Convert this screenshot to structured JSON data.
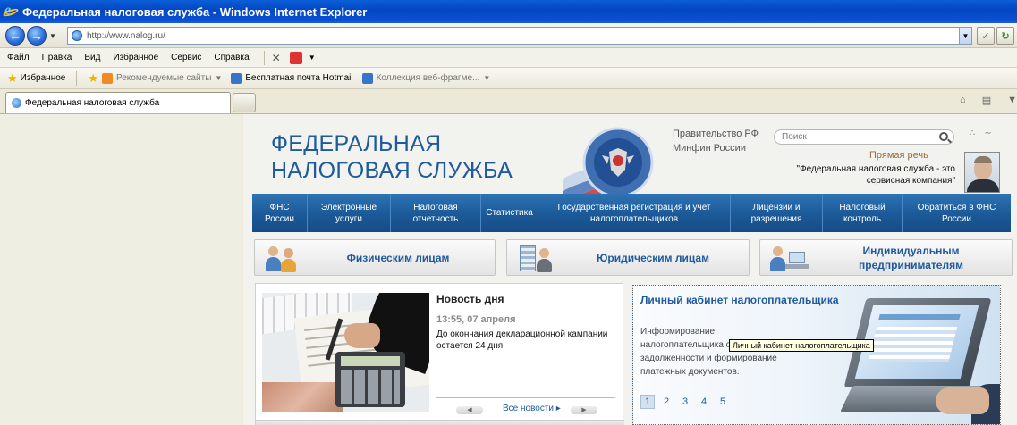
{
  "window": {
    "title": "Федеральная налоговая служба - Windows Internet Explorer"
  },
  "address": {
    "url": "http://www.nalog.ru/"
  },
  "menu": {
    "items": [
      "Файл",
      "Правка",
      "Вид",
      "Избранное",
      "Сервис",
      "Справка"
    ]
  },
  "favorites": {
    "label": "Избранное",
    "items": [
      "Рекомендуемые сайты",
      "Бесплатная почта Hotmail",
      "Коллекция веб-фрагме..."
    ]
  },
  "tab": {
    "title": "Федеральная налоговая служба"
  },
  "site": {
    "logo_line1": "ФЕДЕРАЛЬНАЯ",
    "logo_line2": "НАЛОГОВАЯ СЛУЖБА",
    "gov_links": [
      "Правительство РФ",
      "Минфин России"
    ],
    "search_placeholder": "Поиск",
    "direct_speech": "Прямая речь",
    "quote": "\"Федеральная налоговая служба - это сервисная компания\"",
    "nav": [
      "ФНС России",
      "Электронные услуги",
      "Налоговая отчетность",
      "Статистика",
      "Государственная регистрация и учет налогоплательщиков",
      "Лицензии и разрешения",
      "Налоговый контроль",
      "Обратиться в ФНС России"
    ],
    "categories": [
      "Физическим лицам",
      "Юридическим лицам",
      "Индивидуальным предпринимателям"
    ],
    "news": {
      "heading": "Новость дня",
      "date": "13:55, 07 апреля",
      "text": "До окончания декларационной кампании остается 24 дня",
      "all_news": "Все новости"
    },
    "cabinet": {
      "heading": "Личный кабинет налогоплательщика",
      "text": "Информирование налогоплательщика о задолженности и формирование платежных документов.",
      "pages": [
        "1",
        "2",
        "3",
        "4",
        "5"
      ],
      "active_page": "1",
      "tooltip": "Личный кабинет налогоплательщика"
    }
  }
}
